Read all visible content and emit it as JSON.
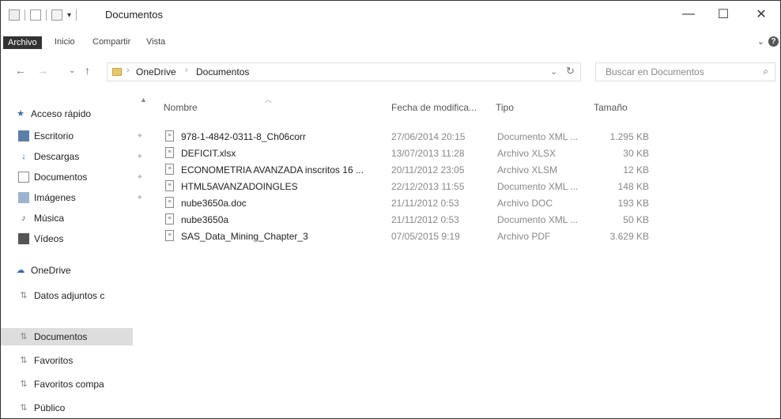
{
  "window": {
    "title": "Documentos",
    "controls": {
      "minimize": "—",
      "maximize": "☐",
      "close": "✕"
    }
  },
  "ribbon": {
    "tabs": [
      {
        "label": "Archivo",
        "active": true
      },
      {
        "label": "Inicio",
        "active": false
      },
      {
        "label": "Compartir",
        "active": false
      },
      {
        "label": "Vista",
        "active": false
      }
    ],
    "expand_icon": "chevron-down-icon",
    "help_icon": "help-icon"
  },
  "address": {
    "crumbs": [
      "OneDrive",
      "Documentos"
    ],
    "search_placeholder": "Buscar en Documentos"
  },
  "sidebar": {
    "quick_access": {
      "label": "Acceso rápido",
      "items": [
        {
          "label": "Escritorio",
          "icon": "desktop-icon"
        },
        {
          "label": "Descargas",
          "icon": "download-icon"
        },
        {
          "label": "Documentos",
          "icon": "document-icon"
        },
        {
          "label": "Imágenes",
          "icon": "image-icon"
        },
        {
          "label": "Música",
          "icon": "music-icon"
        },
        {
          "label": "Vídeos",
          "icon": "video-icon"
        }
      ]
    },
    "onedrive": {
      "label": "OneDrive",
      "items": [
        {
          "label": "Datos adjuntos c",
          "selected": false
        },
        {
          "label": "Documentos",
          "selected": true
        },
        {
          "label": "Favoritos",
          "selected": false
        },
        {
          "label": "Favoritos compa",
          "selected": false
        },
        {
          "label": "Público",
          "selected": false
        }
      ]
    }
  },
  "table": {
    "columns": {
      "name": "Nombre",
      "date": "Fecha de modifica...",
      "type": "Tipo",
      "size": "Tamaño"
    },
    "rows": [
      {
        "name": "978-1-4842-0311-8_Ch06corr",
        "date": "27/06/2014 20:15",
        "type": "Documento XML ...",
        "size": "1.295 KB"
      },
      {
        "name": "DEFICIT.xlsx",
        "date": "13/07/2013 11:28",
        "type": "Archivo XLSX",
        "size": "30 KB"
      },
      {
        "name": "ECONOMETRIA AVANZADA inscritos 16 ...",
        "date": "20/11/2012 23:05",
        "type": "Archivo XLSM",
        "size": "12 KB"
      },
      {
        "name": "HTML5AVANZADOINGLES",
        "date": "22/12/2013 11:55",
        "type": "Documento XML ...",
        "size": "148 KB"
      },
      {
        "name": "nube3650a.doc",
        "date": "21/11/2012 0:53",
        "type": "Archivo DOC",
        "size": "193 KB"
      },
      {
        "name": "nube3650a",
        "date": "21/11/2012 0:53",
        "type": "Documento XML ...",
        "size": "50 KB"
      },
      {
        "name": "SAS_Data_Mining_Chapter_3",
        "date": "07/05/2015 9:19",
        "type": "Archivo PDF",
        "size": "3.629 KB"
      }
    ]
  }
}
